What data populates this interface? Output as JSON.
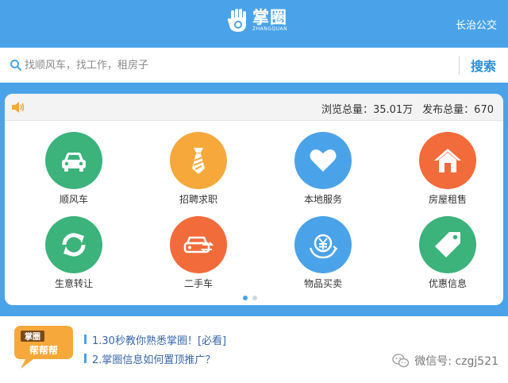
{
  "header": {
    "logo_cn": "掌圈",
    "logo_en": "ZHANGQUAN",
    "city": "长治公交"
  },
  "search": {
    "placeholder": "找顺风车，找工作，租房子",
    "button_label": "搜索"
  },
  "stats": {
    "views": "浏览总量：35.01万",
    "posts": "发布总量：670"
  },
  "categories": [
    {
      "label": "顺风车",
      "color": "#3bb37b",
      "icon": "car-icon"
    },
    {
      "label": "招聘求职",
      "color": "#f6a83a",
      "icon": "tie-icon"
    },
    {
      "label": "本地服务",
      "color": "#4aa3e8",
      "icon": "heart-icon"
    },
    {
      "label": "房屋租售",
      "color": "#f26b3a",
      "icon": "house-icon"
    },
    {
      "label": "生意转让",
      "color": "#3bb37b",
      "icon": "refresh-icon"
    },
    {
      "label": "二手车",
      "color": "#f26b3a",
      "icon": "used-car-icon"
    },
    {
      "label": "物品买卖",
      "color": "#4aa3e8",
      "icon": "yen-exchange-icon"
    },
    {
      "label": "优惠信息",
      "color": "#3bb37b",
      "icon": "tag-icon"
    }
  ],
  "pager": {
    "pages": 2,
    "current": 1
  },
  "promo": {
    "badge_line1": "掌圈",
    "badge_line2": "帮帮帮",
    "news": [
      "1.30秒教你熟悉掌圈！[必看]",
      "2.掌圈信息如何置顶推广？"
    ]
  },
  "watermark": "微信号: czgj521"
}
